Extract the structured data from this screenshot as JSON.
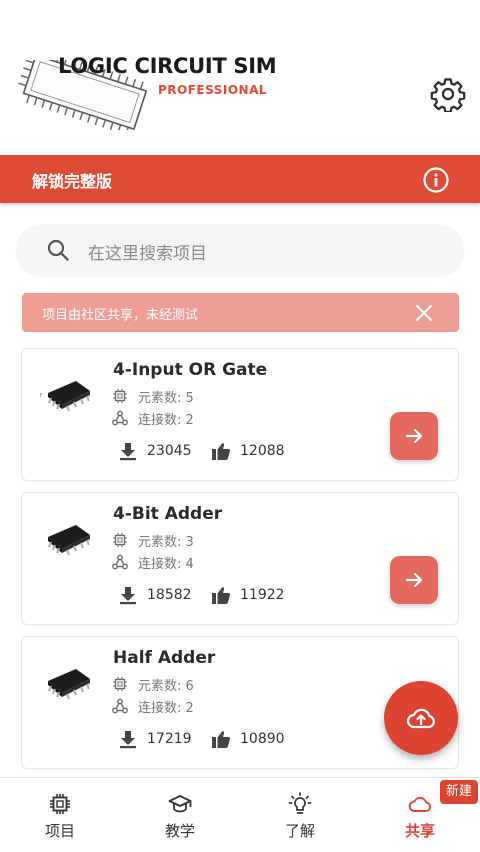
{
  "header": {
    "logo_title": "LOGIC CIRCUIT SIM",
    "logo_subtitle": "PROFESSIONAL",
    "settings_icon": "gear-icon"
  },
  "unlock": {
    "label": "解锁完整版",
    "icon": "info-icon"
  },
  "search": {
    "placeholder": "在这里搜索项目"
  },
  "notice": {
    "text": "项目由社区共享，未经测试"
  },
  "projects": [
    {
      "title": "4-Input OR Gate",
      "elements": "元素数: 5",
      "connections": "连接数: 2",
      "downloads": "23045",
      "likes": "12088"
    },
    {
      "title": "4-Bit Adder",
      "elements": "元素数: 3",
      "connections": "连接数: 4",
      "downloads": "18582",
      "likes": "11922"
    },
    {
      "title": "Half Adder",
      "elements": "元素数: 6",
      "connections": "连接数: 2",
      "downloads": "17219",
      "likes": "10890"
    }
  ],
  "nav": {
    "items": [
      {
        "label": "项目",
        "icon": "chip-icon"
      },
      {
        "label": "教学",
        "icon": "graduation-cap-icon"
      },
      {
        "label": "了解",
        "icon": "lightbulb-icon"
      },
      {
        "label": "共享",
        "icon": "cloud-icon",
        "active": true
      }
    ],
    "badge": "新建"
  },
  "colors": {
    "accent": "#dd4a35",
    "notice_bg": "#ef9e96",
    "button": "#e36a5c"
  }
}
